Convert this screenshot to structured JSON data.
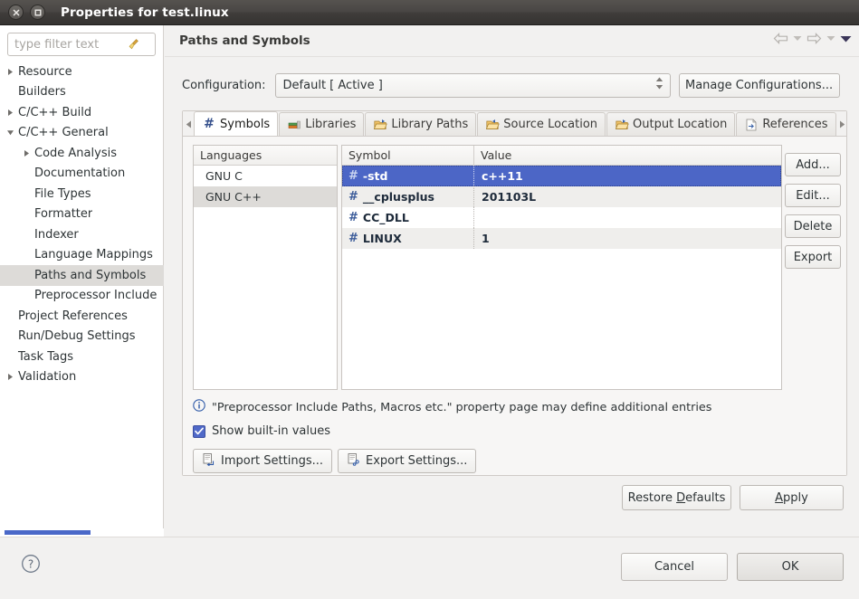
{
  "window": {
    "title": "Properties for test.linux",
    "close_icon": "close-icon",
    "maximize_icon": "maximize-icon"
  },
  "sidebar": {
    "filter": {
      "value": "",
      "placeholder": "type filter text",
      "clear_icon": "broom-icon"
    },
    "items": [
      {
        "label": "Resource",
        "indent": 0,
        "twisty": "collapsed",
        "selected": false
      },
      {
        "label": "Builders",
        "indent": 0,
        "twisty": "none",
        "selected": false
      },
      {
        "label": "C/C++ Build",
        "indent": 0,
        "twisty": "collapsed",
        "selected": false
      },
      {
        "label": "C/C++ General",
        "indent": 0,
        "twisty": "expanded",
        "selected": false
      },
      {
        "label": "Code Analysis",
        "indent": 1,
        "twisty": "collapsed",
        "selected": false
      },
      {
        "label": "Documentation",
        "indent": 1,
        "twisty": "none",
        "selected": false
      },
      {
        "label": "File Types",
        "indent": 1,
        "twisty": "none",
        "selected": false
      },
      {
        "label": "Formatter",
        "indent": 1,
        "twisty": "none",
        "selected": false
      },
      {
        "label": "Indexer",
        "indent": 1,
        "twisty": "none",
        "selected": false
      },
      {
        "label": "Language Mappings",
        "indent": 1,
        "twisty": "none",
        "selected": false
      },
      {
        "label": "Paths and Symbols",
        "indent": 1,
        "twisty": "none",
        "selected": true
      },
      {
        "label": "Preprocessor Include",
        "indent": 1,
        "twisty": "none",
        "selected": false
      },
      {
        "label": "Project References",
        "indent": 0,
        "twisty": "none",
        "selected": false
      },
      {
        "label": "Run/Debug Settings",
        "indent": 0,
        "twisty": "none",
        "selected": false
      },
      {
        "label": "Task Tags",
        "indent": 0,
        "twisty": "none",
        "selected": false
      },
      {
        "label": "Validation",
        "indent": 0,
        "twisty": "collapsed",
        "selected": false
      }
    ]
  },
  "header": {
    "title": "Paths and Symbols",
    "nav": [
      {
        "name": "back-arrow-icon"
      },
      {
        "name": "back-dropdown-icon"
      },
      {
        "name": "forward-arrow-icon"
      },
      {
        "name": "forward-dropdown-icon"
      },
      {
        "name": "view-menu-chevron-icon"
      }
    ]
  },
  "configuration": {
    "label": "Configuration:",
    "value": "Default  [ Active ]",
    "manage_label": "Manage Configurations..."
  },
  "tabs": {
    "scroll_left_icon": "scroll-left-icon",
    "scroll_right_icon": "scroll-right-icon",
    "items": [
      {
        "label": "Symbols",
        "icon": "hash-icon",
        "active": true
      },
      {
        "label": "Libraries",
        "icon": "books-icon",
        "active": false
      },
      {
        "label": "Library Paths",
        "icon": "folder-open-icon",
        "active": false
      },
      {
        "label": "Source Location",
        "icon": "folder-in-icon",
        "active": false
      },
      {
        "label": "Output Location",
        "icon": "folder-out-icon",
        "active": false
      },
      {
        "label": "References",
        "icon": "document-ref-icon",
        "active": false
      }
    ]
  },
  "languages": {
    "header": "Languages",
    "rows": [
      {
        "label": "GNU C",
        "selected": false
      },
      {
        "label": "GNU C++",
        "selected": true
      }
    ]
  },
  "symbols_table": {
    "headers": {
      "symbol": "Symbol",
      "value": "Value"
    },
    "rows": [
      {
        "icon": "hash-icon",
        "symbol": "-std",
        "value": "c++11",
        "selected": true
      },
      {
        "icon": "hash-icon",
        "symbol": "__cplusplus",
        "value": "201103L",
        "selected": false
      },
      {
        "icon": "hash-icon",
        "symbol": "CC_DLL",
        "value": "",
        "selected": false
      },
      {
        "icon": "hash-icon",
        "symbol": "LINUX",
        "value": "1",
        "selected": false
      }
    ]
  },
  "side_buttons": [
    {
      "label": "Add..."
    },
    {
      "label": "Edit..."
    },
    {
      "label": "Delete"
    },
    {
      "label": "Export"
    }
  ],
  "info": {
    "icon": "info-icon",
    "text": "\"Preprocessor Include Paths, Macros etc.\" property page may define additional entries"
  },
  "show_builtin": {
    "label": "Show built-in values",
    "checked": true
  },
  "settings_buttons": {
    "import": {
      "label": "Import Settings...",
      "icon": "import-icon"
    },
    "export": {
      "label": "Export Settings...",
      "icon": "export-icon"
    }
  },
  "apply_row": {
    "restore_defaults": {
      "pre": "Restore ",
      "mnemonic": "D",
      "post": "efaults"
    },
    "apply": {
      "pre": "",
      "mnemonic": "A",
      "post": "pply"
    }
  },
  "dialog_buttons": {
    "help_icon": "help-icon",
    "cancel": "Cancel",
    "ok": "OK"
  },
  "colors": {
    "selection_blue": "#4c66c6",
    "scrollbar_blue": "#4a68c8",
    "hash_blue": "#3c5c9a",
    "titlebar_dark": "#403d3b",
    "panel_bg": "#f2f1f0"
  }
}
